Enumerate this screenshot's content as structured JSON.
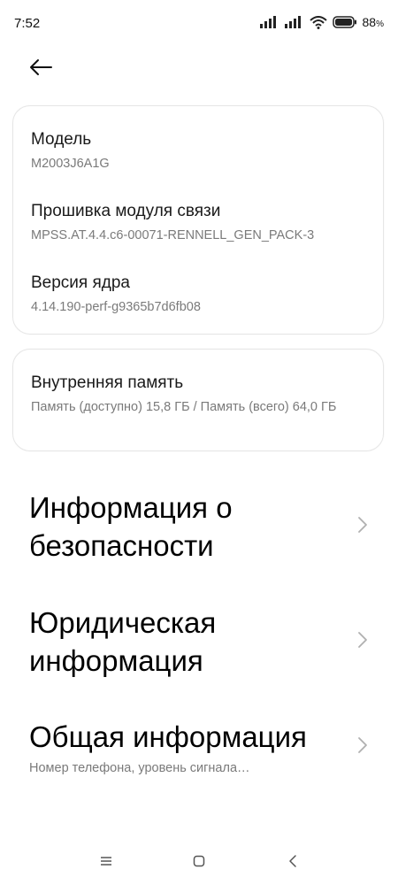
{
  "status": {
    "time": "7:52",
    "battery": "88"
  },
  "card1": {
    "model_title": "Модель",
    "model_value": "M2003J6A1G",
    "baseband_title": "Прошивка модуля связи",
    "baseband_value": "MPSS.AT.4.4.c6-00071-RENNELL_GEN_PACK-3",
    "kernel_title": "Версия ядра",
    "kernel_value": "4.14.190-perf-g9365b7d6fb08"
  },
  "card2": {
    "storage_title": "Внутренняя память",
    "storage_value": "Память (доступно)  15,8 ГБ / Память (всего) 64,0 ГБ"
  },
  "items": [
    {
      "title": "Информация о безопасности",
      "subtitle": ""
    },
    {
      "title": "Юридическая информация",
      "subtitle": ""
    },
    {
      "title": "Общая информация",
      "subtitle": "Номер телефона, уровень сигнала…"
    }
  ],
  "colors": {
    "text": "#000000",
    "secondary": "#7a7a7a",
    "card_border": "#e6e6e6",
    "chevron": "#b0b0b0"
  }
}
